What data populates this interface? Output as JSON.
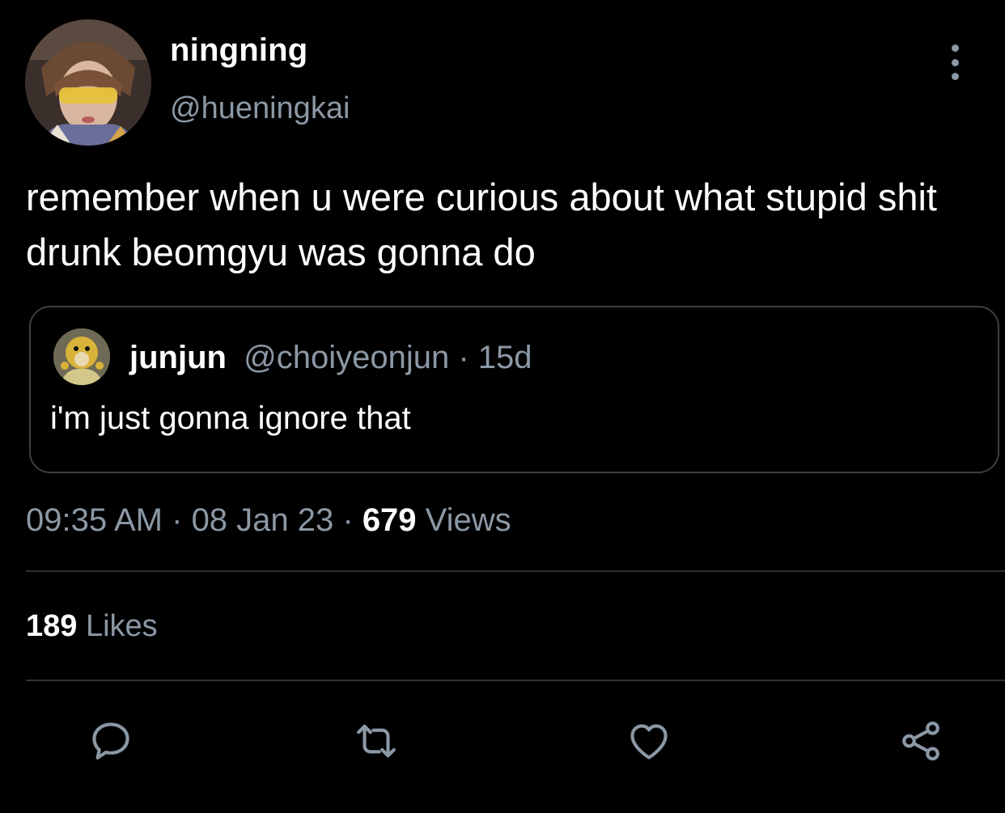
{
  "tweet": {
    "display_name": "ningning",
    "handle": "@hueningkai",
    "text": "remember when u were curious about what stupid shit drunk beomgyu was gonna do",
    "avatar_icon": "user-avatar"
  },
  "quote": {
    "display_name": "junjun",
    "handle": "@choiyeonjun",
    "separator": " · ",
    "age": "15d",
    "text": "i'm just gonna ignore that",
    "avatar_icon": "quoted-user-avatar"
  },
  "meta": {
    "time": "09:35 AM",
    "sep1": " · ",
    "date": "08 Jan 23",
    "sep2": " · ",
    "views_count": "679",
    "views_label": " Views"
  },
  "engagement": {
    "likes_count": "189",
    "likes_label": " Likes"
  },
  "actions": [
    {
      "icon": "reply-icon"
    },
    {
      "icon": "retweet-icon"
    },
    {
      "icon": "heart-icon"
    },
    {
      "icon": "share-icon"
    }
  ],
  "colors": {
    "background": "#000000",
    "primary_text": "#ffffff",
    "secondary_text": "#8b98a5",
    "border": "#2f3336"
  }
}
